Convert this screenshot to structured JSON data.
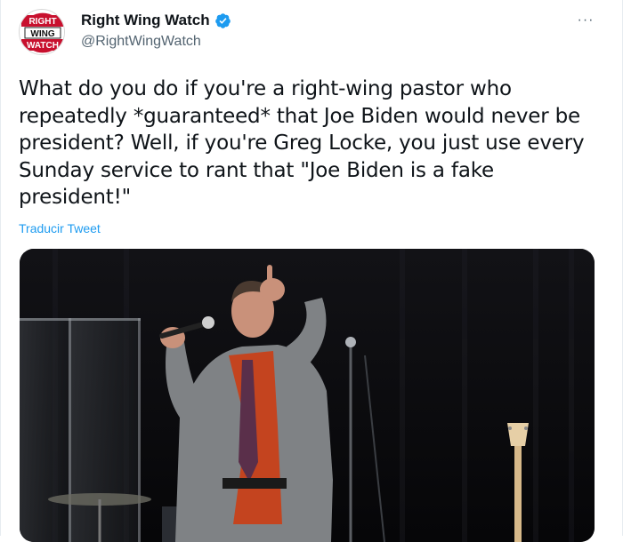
{
  "account": {
    "display_name": "Right Wing Watch",
    "handle": "@RightWingWatch",
    "verified": true,
    "avatar_logo_text": [
      "RIGHT",
      "WING",
      "WATCH"
    ],
    "brand_color": "#c8102e"
  },
  "tweet": {
    "text": "What do you do if you're a right-wing pastor who repeatedly *guaranteed* that Joe Biden would never be president? Well, if you're Greg Locke, you just use every Sunday service to rant that \"Joe Biden is a fake president!\"",
    "translate_label": "Traducir Tweet",
    "more_label": "···"
  },
  "media": {
    "type": "video-still",
    "description_icon": "video-media"
  },
  "colors": {
    "link": "#1d9bf0",
    "verified": "#1d9bf0",
    "secondary_text": "#536471"
  }
}
